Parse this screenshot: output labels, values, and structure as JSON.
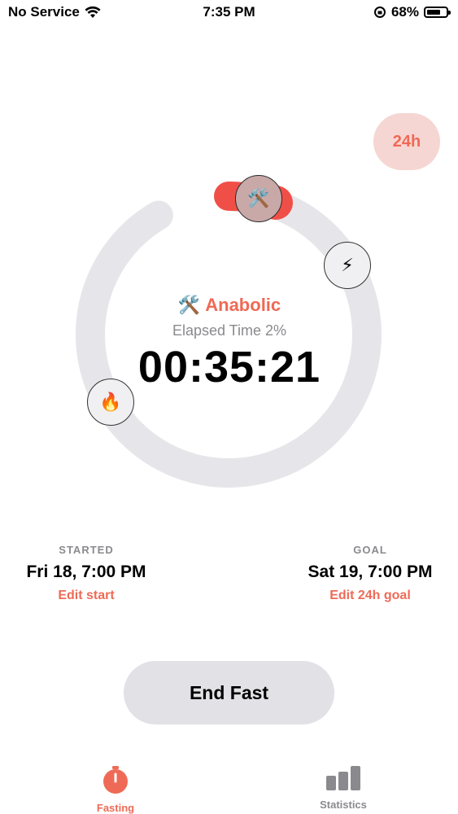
{
  "status_bar": {
    "carrier": "No Service",
    "time": "7:35 PM",
    "battery_percent": "68%",
    "battery_level": 0.68
  },
  "goal_pill": {
    "label": "24h"
  },
  "ring": {
    "progress_fraction": 0.02,
    "track_color": "#e6e6ea",
    "accent_color": "#f04f47"
  },
  "phases": [
    {
      "name": "anabolic",
      "icon": "hammer-wrench-icon",
      "glyph": "🛠️",
      "active": true
    },
    {
      "name": "lightning",
      "icon": "lightning-icon",
      "glyph": "⚡",
      "active": false
    },
    {
      "name": "fire",
      "icon": "fire-icon",
      "glyph": "🔥",
      "active": false
    }
  ],
  "center": {
    "phase_emoji": "🛠️",
    "phase_name": "Anabolic",
    "elapsed_label": "Elapsed Time 2%",
    "timer": "00:35:21"
  },
  "started": {
    "caption": "STARTED",
    "value": "Fri 18, 7:00 PM",
    "edit_label": "Edit start"
  },
  "goal": {
    "caption": "GOAL",
    "value": "Sat 19, 7:00 PM",
    "edit_label": "Edit 24h goal"
  },
  "end_button": {
    "label": "End Fast"
  },
  "tabs": [
    {
      "label": "Fasting",
      "icon": "stopwatch-icon",
      "active": true
    },
    {
      "label": "Statistics",
      "icon": "bar-chart-icon",
      "active": false
    }
  ],
  "colors": {
    "accent": "#ef6a56",
    "secondary_text": "#8a8a8e",
    "button_bg": "#e1e1e6",
    "pill_bg": "#f6d6d2"
  }
}
